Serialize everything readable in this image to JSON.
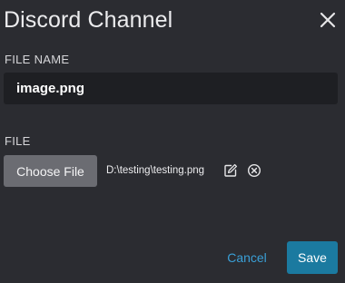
{
  "dialog": {
    "title": "Discord Channel",
    "close_icon": "close-icon"
  },
  "file_name": {
    "label": "FILE NAME",
    "value": "image.png"
  },
  "file": {
    "label": "FILE",
    "choose_button_label": "Choose File",
    "path": "D:\\testing\\testing.png",
    "edit_icon": "edit-icon",
    "remove_icon": "remove-circle-icon"
  },
  "actions": {
    "cancel_label": "Cancel",
    "save_label": "Save"
  },
  "colors": {
    "background": "#2b2c31",
    "input_background": "#1e1f23",
    "choose_button": "#6b6c72",
    "accent_link": "#3a9fd6",
    "save_button": "#1b7aa0"
  }
}
